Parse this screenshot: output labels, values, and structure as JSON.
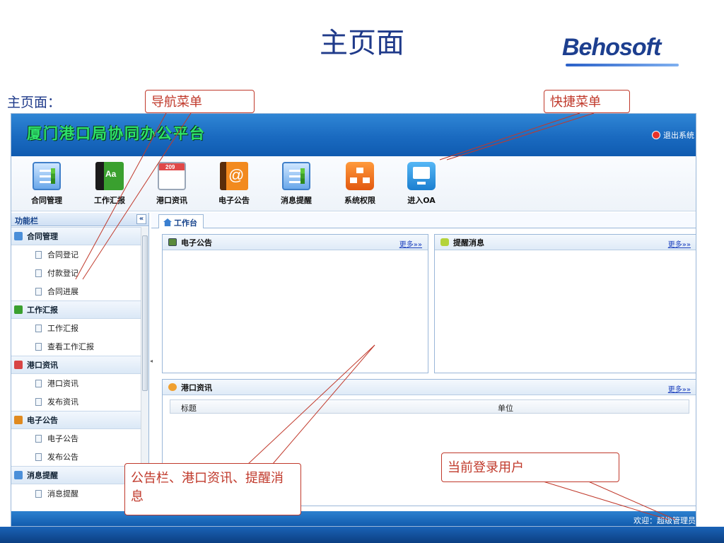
{
  "slide": {
    "title": "主页面",
    "brand": "Behosoft",
    "subtitle": "主页面："
  },
  "app": {
    "title": "厦门港口局协同办公平台",
    "logout_label": "退出系统"
  },
  "toolbar": {
    "items": [
      {
        "label": "合同管理",
        "icon": "contract-icon"
      },
      {
        "label": "工作汇报",
        "icon": "report-book-icon"
      },
      {
        "label": "港口资讯",
        "icon": "calendar-icon"
      },
      {
        "label": "电子公告",
        "icon": "address-book-icon"
      },
      {
        "label": "消息提醒",
        "icon": "message-list-icon"
      },
      {
        "label": "系统权限",
        "icon": "hierarchy-icon"
      },
      {
        "label": "进入OA",
        "icon": "monitor-icon"
      }
    ]
  },
  "sidebar": {
    "title": "功能栏",
    "collapse_glyph": "«",
    "groups": [
      {
        "label": "合同管理",
        "items": [
          "合同登记",
          "付款登记",
          "合同进展"
        ]
      },
      {
        "label": "工作汇报",
        "items": [
          "工作汇报",
          "查看工作汇报"
        ]
      },
      {
        "label": "港口资讯",
        "items": [
          "港口资讯",
          "发布资讯"
        ]
      },
      {
        "label": "电子公告",
        "items": [
          "电子公告",
          "发布公告"
        ]
      },
      {
        "label": "消息提醒",
        "items": [
          "消息提醒"
        ]
      }
    ]
  },
  "tabs": [
    {
      "label": "工作台"
    }
  ],
  "panels": {
    "notice": {
      "title": "电子公告",
      "more": "更多»»"
    },
    "remind": {
      "title": "提醒消息",
      "more": "更多»»"
    },
    "port": {
      "title": "港口资讯",
      "more": "更多»»",
      "columns": [
        "标题",
        "单位"
      ]
    }
  },
  "status": {
    "welcome": "欢迎：超级管理员"
  },
  "callouts": {
    "nav": "导航菜单",
    "quick": "快捷菜单",
    "board": "公告栏、港口资讯、提醒消息",
    "user": "当前登录用户"
  },
  "colors": {
    "header": "#1a6ac0",
    "annotation": "#c0392b",
    "title_text": "#1f3a8a"
  }
}
